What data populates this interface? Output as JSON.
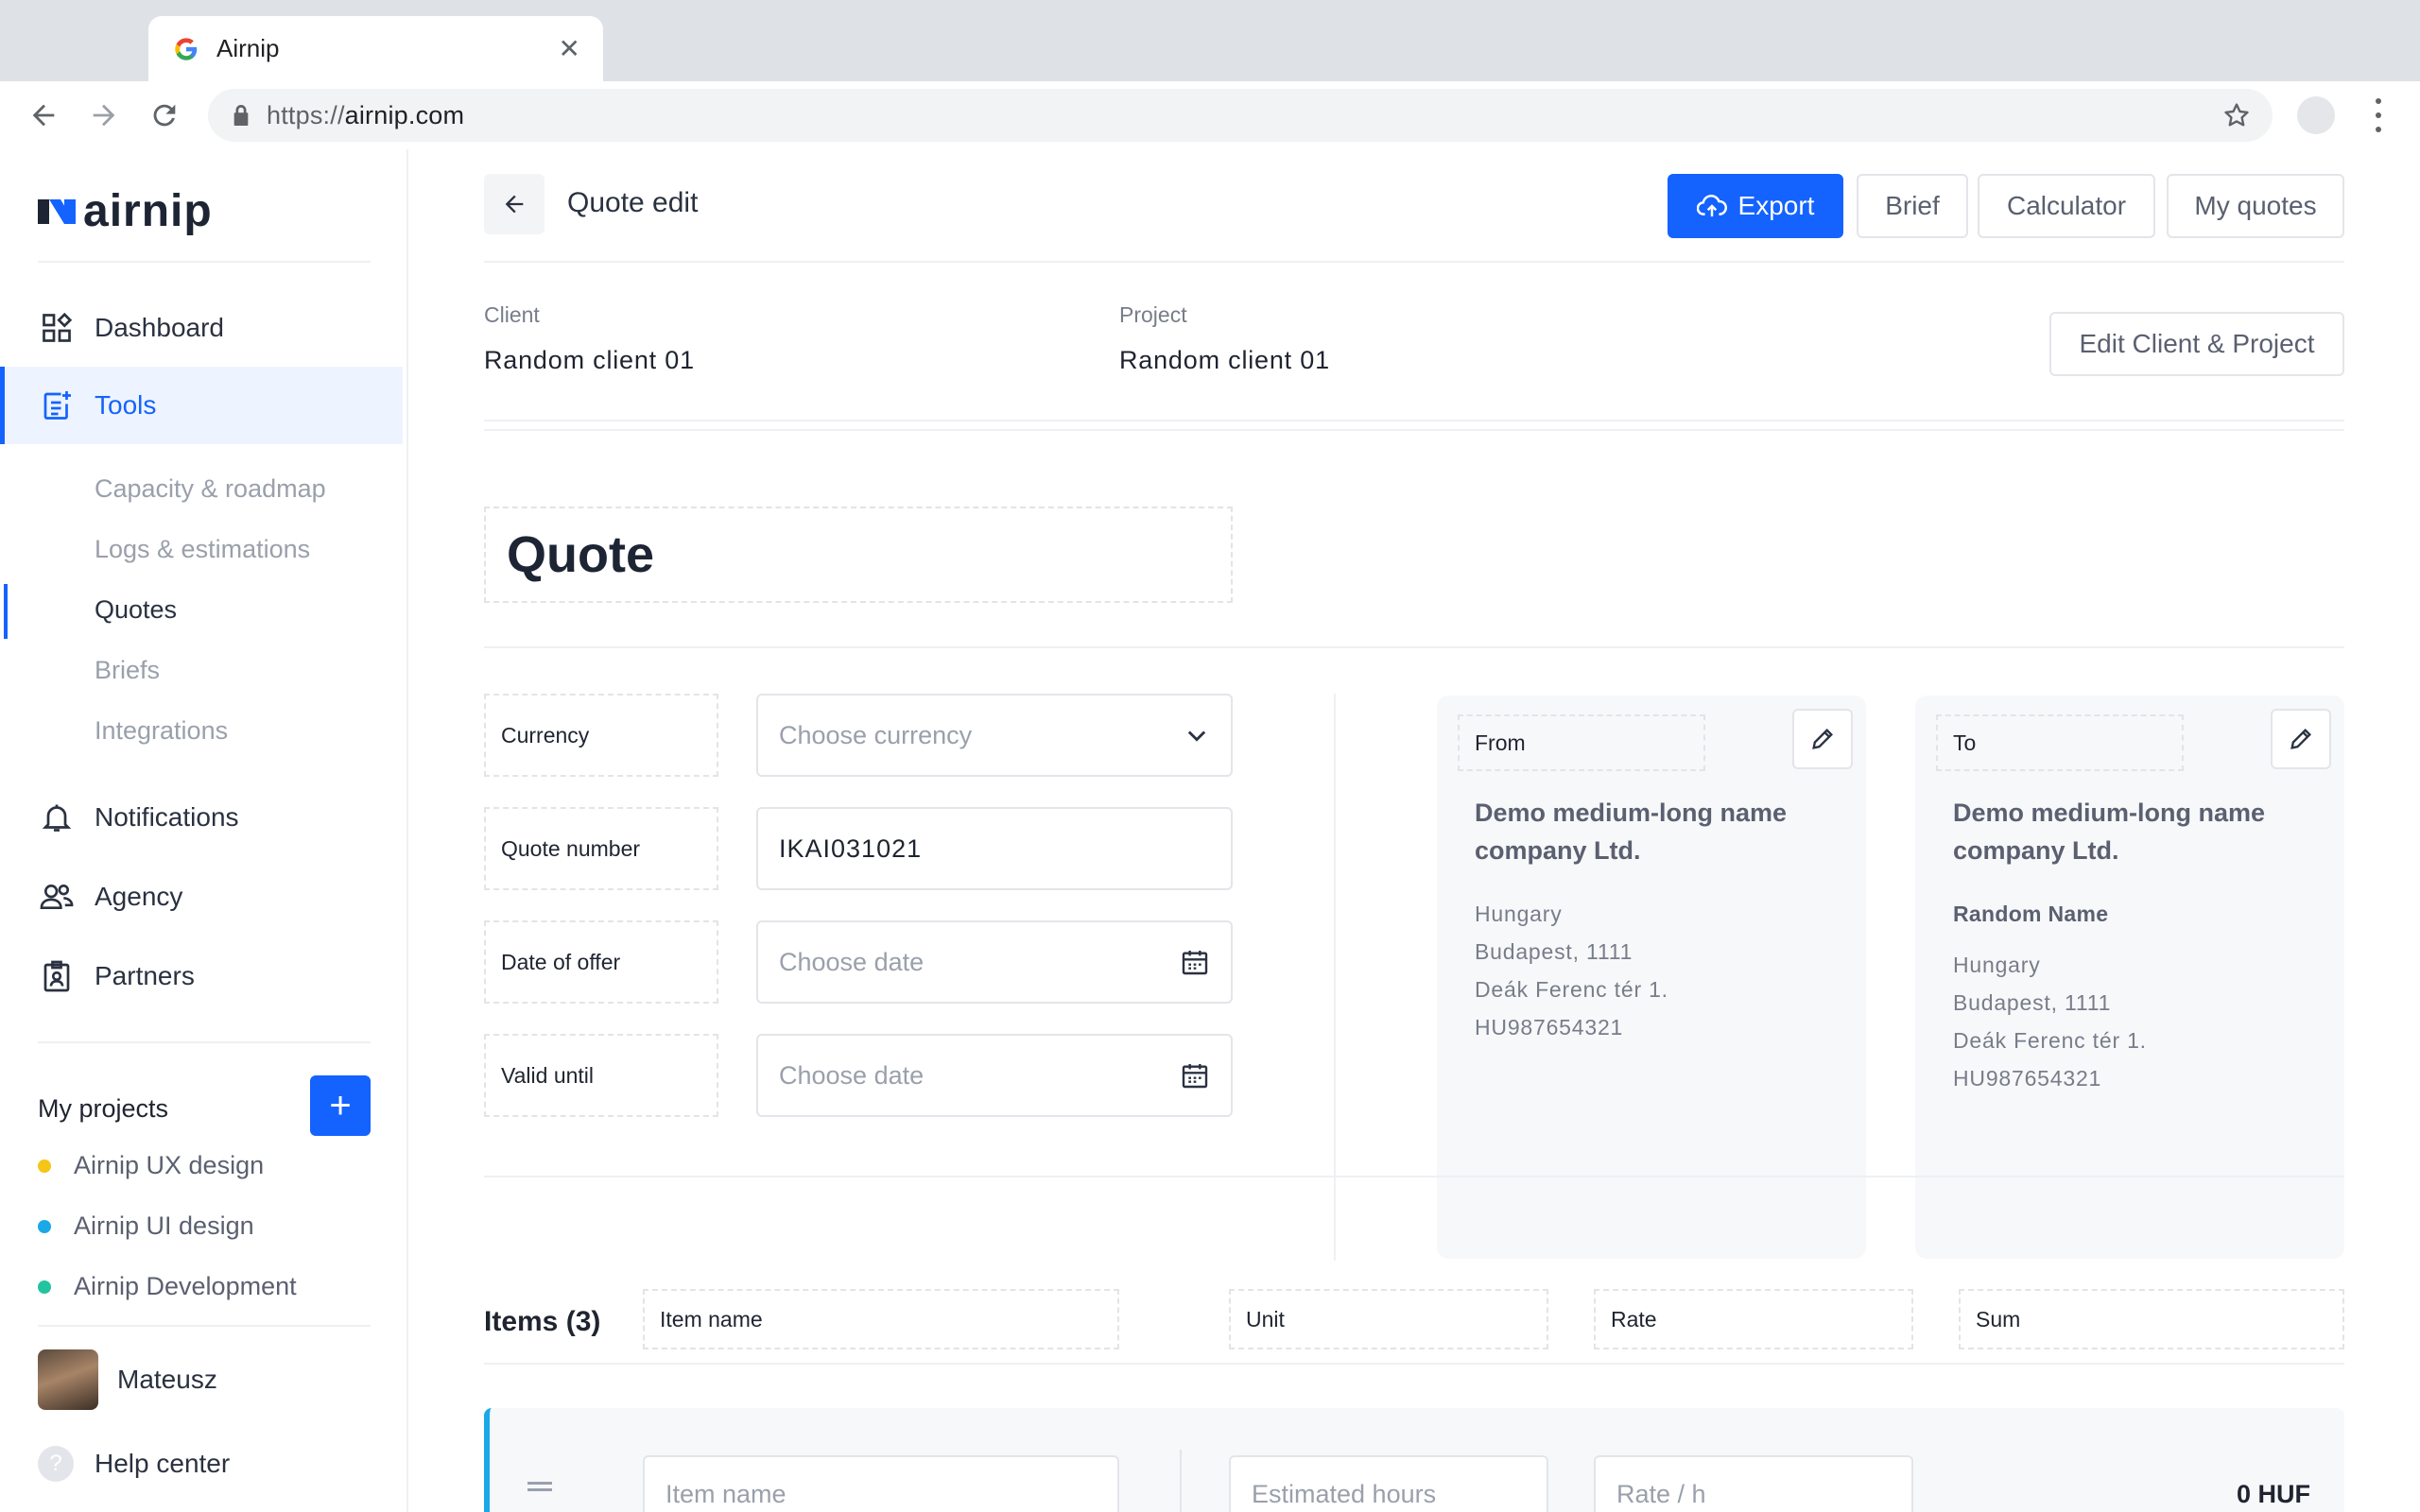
{
  "browser": {
    "tab_title": "Airnip",
    "url_scheme": "https://",
    "url_host": "airnip.com"
  },
  "sidebar": {
    "logo_text": "airnip",
    "nav": [
      {
        "label": "Dashboard",
        "icon": "dashboard-icon"
      },
      {
        "label": "Tools",
        "icon": "tools-icon"
      },
      {
        "label": "Notifications",
        "icon": "bell-icon"
      },
      {
        "label": "Agency",
        "icon": "users-icon"
      },
      {
        "label": "Partners",
        "icon": "badge-icon"
      }
    ],
    "tools_sub": [
      "Capacity & roadmap",
      "Logs & estimations",
      "Quotes",
      "Briefs",
      "Integrations"
    ],
    "projects_title": "My projects",
    "add_project_label": "+",
    "projects": [
      {
        "name": "Airnip UX design",
        "color": "#f5c518"
      },
      {
        "name": "Airnip UI design",
        "color": "#1aa8e8"
      },
      {
        "name": "Airnip Development",
        "color": "#22c4a0"
      }
    ],
    "user_name": "Mateusz",
    "help_label": "Help center"
  },
  "header": {
    "title": "Quote edit",
    "export_label": "Export",
    "brief_label": "Brief",
    "calculator_label": "Calculator",
    "my_quotes_label": "My quotes"
  },
  "meta": {
    "client_label": "Client",
    "client_value": "Random client 01",
    "project_label": "Project",
    "project_value": "Random client 01",
    "edit_label": "Edit Client & Project"
  },
  "quote": {
    "title": "Quote",
    "fields": [
      {
        "label": "Currency",
        "value": "",
        "placeholder": "Choose currency"
      },
      {
        "label": "Quote number",
        "value": "IKAI031021",
        "placeholder": ""
      },
      {
        "label": "Date of offer",
        "value": "",
        "placeholder": "Choose date"
      },
      {
        "label": "Valid until",
        "value": "",
        "placeholder": "Choose date"
      }
    ]
  },
  "from": {
    "label": "From",
    "company": "Demo medium-long name company Ltd.",
    "country": "Hungary",
    "city": "Budapest, 1111",
    "street": "Deák Ferenc tér 1.",
    "tax": "HU987654321"
  },
  "to": {
    "label": "To",
    "company": "Demo medium-long name company Ltd.",
    "person": "Random Name",
    "country": "Hungary",
    "city": "Budapest, 1111",
    "street": "Deák Ferenc tér 1.",
    "tax": "HU987654321"
  },
  "items": {
    "title": "Items (3)",
    "columns": [
      "Item name",
      "Unit",
      "Rate",
      "Sum"
    ],
    "row": {
      "name_placeholder": "Item name",
      "hours_placeholder": "Estimated hours",
      "rate_placeholder": "Rate / h",
      "sum": "0 HUF"
    }
  }
}
